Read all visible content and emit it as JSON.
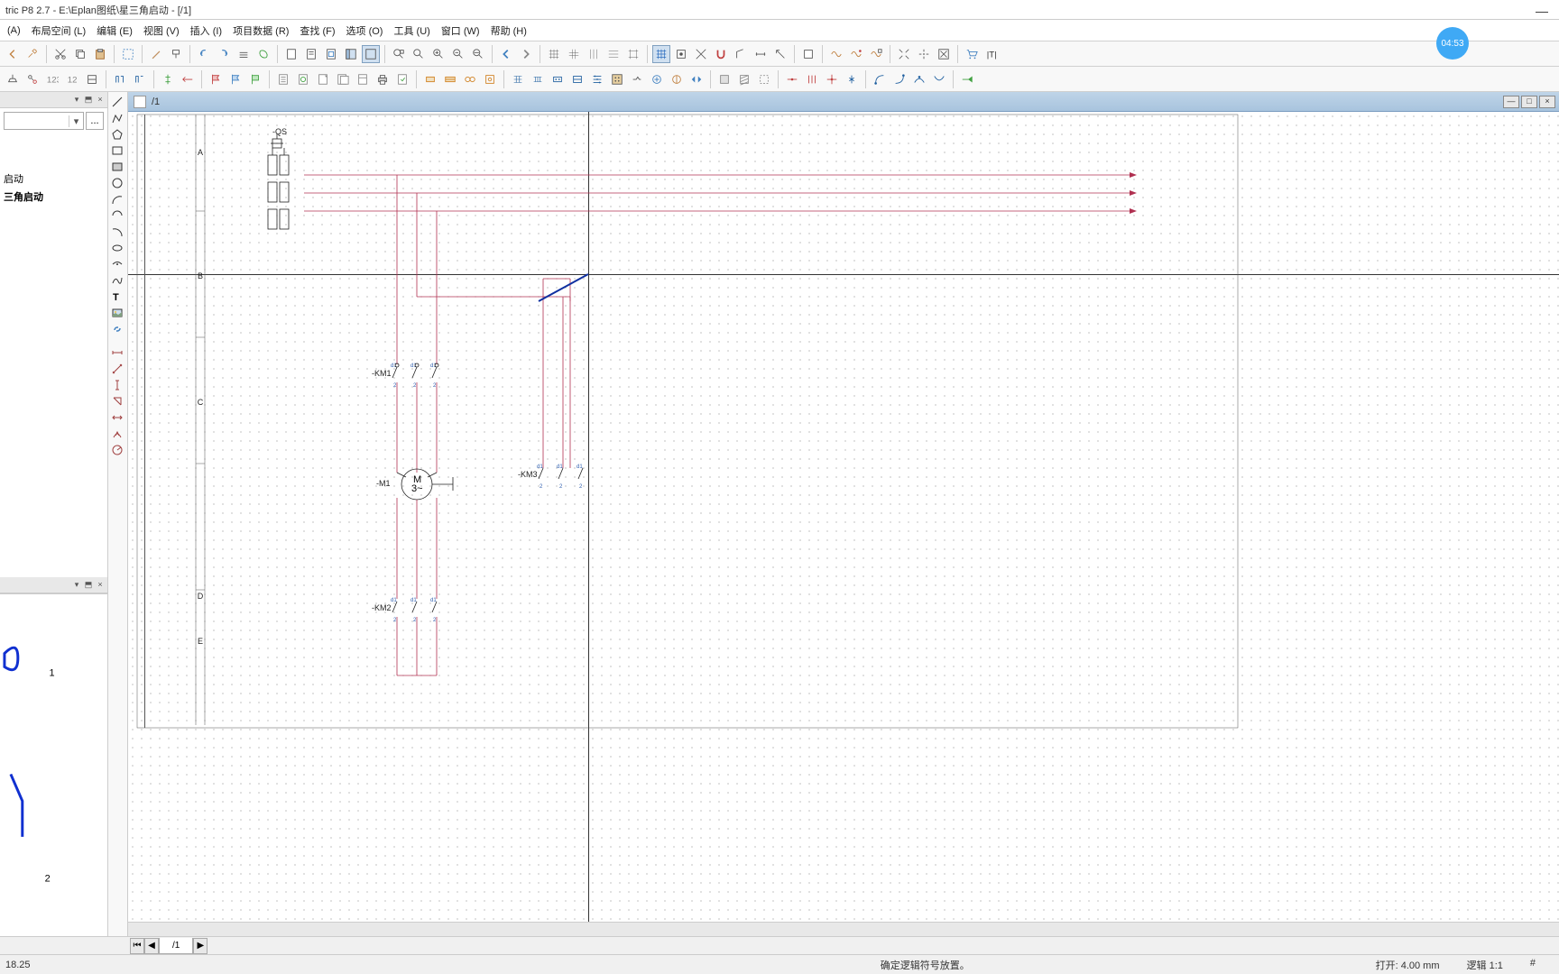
{
  "title": "tric P8 2.7 - E:\\Eplan图纸\\星三角启动 - [/1]",
  "menus": [
    "(A)",
    "布局空间 (L)",
    "编辑 (E)",
    "视图 (V)",
    "插入 (I)",
    "项目数据 (R)",
    "查找 (F)",
    "选项 (O)",
    "工具 (U)",
    "窗口 (W)",
    "帮助 (H)"
  ],
  "time_badge": "04:53",
  "tree": {
    "item1": "启动",
    "item2": "三角启动"
  },
  "doc_tab": "/1",
  "page_tab": "/1",
  "components": {
    "qs": "-QS",
    "km1": "-KM1",
    "km2": "-KM2",
    "km3": "-KM3",
    "m1": "-M1",
    "motor": "M",
    "motor3": "3~"
  },
  "preview": {
    "num1": "1",
    "num2": "2"
  },
  "status": {
    "left": "18.25",
    "center": "确定逻辑符号放置。",
    "open": "打开: 4.00  mm",
    "zoom": "逻辑 1:1",
    "hash": "#"
  },
  "row_labels": {
    "a": "A",
    "b": "B",
    "c": "C",
    "d": "D",
    "e": "E"
  }
}
